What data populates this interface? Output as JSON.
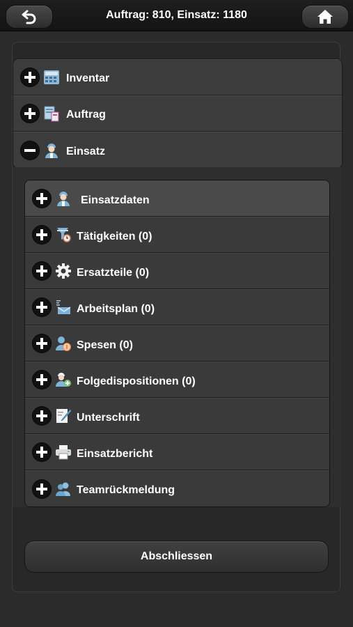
{
  "header": {
    "title": "Auftrag: 810, Einsatz: 1180",
    "back_icon": "undo-arrow-icon",
    "home_icon": "home-icon"
  },
  "sections": [
    {
      "label": "Inventar",
      "toggle": "+",
      "icon": "inventory-icon"
    },
    {
      "label": "Auftrag",
      "toggle": "+",
      "icon": "order-documents-icon"
    },
    {
      "label": "Einsatz",
      "toggle": "−",
      "icon": "technician-icon"
    }
  ],
  "einsatz_items": [
    {
      "label": "Einsatzdaten",
      "toggle": "+",
      "icon": "technician-icon"
    },
    {
      "label": "Tätigkeiten (0)",
      "toggle": "+",
      "icon": "activities-clock-icon"
    },
    {
      "label": "Ersatzteile (0)",
      "toggle": "+",
      "icon": "gear-icon"
    },
    {
      "label": "Arbeitsplan (0)",
      "toggle": "+",
      "icon": "work-plan-icon"
    },
    {
      "label": "Spesen (0)",
      "toggle": "+",
      "icon": "expenses-person-icon"
    },
    {
      "label": "Folgedispositionen (0)",
      "toggle": "+",
      "icon": "person-add-icon"
    },
    {
      "label": "Unterschrift",
      "toggle": "+",
      "icon": "signature-pencil-icon"
    },
    {
      "label": "Einsatzbericht",
      "toggle": "+",
      "icon": "printer-icon"
    },
    {
      "label": "Teamrückmeldung",
      "toggle": "+",
      "icon": "team-icon"
    }
  ],
  "actions": {
    "finish_label": "Abschliessen"
  },
  "colors": {
    "background": "#2b2b2b",
    "topbar": "#141414",
    "row": "#3c3c3c",
    "icon_blue": "#7fb5d8"
  }
}
